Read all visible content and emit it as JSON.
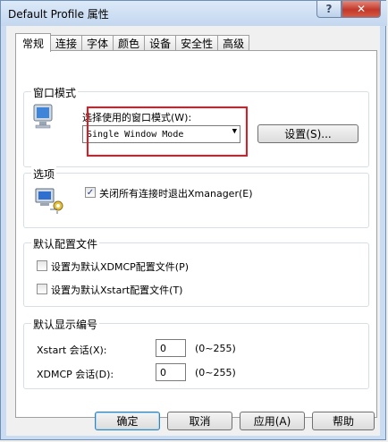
{
  "window": {
    "title": "Default Profile 属性",
    "help_glyph": "?",
    "close_glyph": "✕"
  },
  "tabs": [
    {
      "label": "常规",
      "active": true
    },
    {
      "label": "连接"
    },
    {
      "label": "字体"
    },
    {
      "label": "颜色"
    },
    {
      "label": "设备"
    },
    {
      "label": "安全性"
    },
    {
      "label": "高级"
    }
  ],
  "window_mode": {
    "group_label": "窗口模式",
    "prompt": "选择使用的窗口模式(W):",
    "selected": "Single Window Mode",
    "settings_button": "设置(S)..."
  },
  "options": {
    "group_label": "选项",
    "close_exit_label": "关闭所有连接时退出Xmanager(E)",
    "close_exit_checked": true
  },
  "default_config": {
    "group_label": "默认配置文件",
    "xdmcp_label": "设置为默认XDMCP配置文件(P)",
    "xstart_label": "设置为默认Xstart配置文件(T)"
  },
  "default_display": {
    "group_label": "默认显示编号",
    "xstart_label": "Xstart 会话(X):",
    "xstart_value": "0",
    "xstart_range": "(0~255)",
    "xdmcp_label": "XDMCP 会话(D):",
    "xdmcp_value": "0",
    "xdmcp_range": "(0~255)"
  },
  "buttons": {
    "ok": "确定",
    "cancel": "取消",
    "apply": "应用(A)",
    "help": "帮助"
  }
}
